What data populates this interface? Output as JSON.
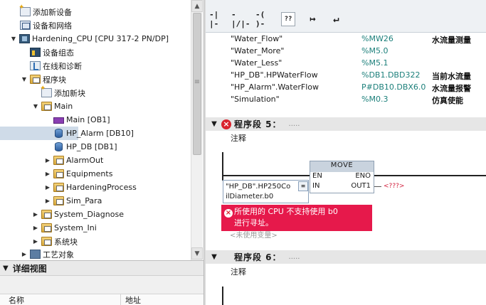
{
  "tree": {
    "items": [
      {
        "label": "添加新设备",
        "icon": "add-new-icon"
      },
      {
        "label": "设备和网络",
        "icon": "network-icon"
      },
      {
        "label": "Hardening_CPU [CPU 317-2 PN/DP]",
        "icon": "cpu-icon"
      },
      {
        "label": "设备组态",
        "icon": "device-config-icon"
      },
      {
        "label": "在线和诊断",
        "icon": "online-diagnostics-icon"
      },
      {
        "label": "程序块",
        "icon": "folder-icon"
      },
      {
        "label": "添加新块",
        "icon": "add-new-icon"
      },
      {
        "label": "Main",
        "icon": "folder-icon"
      },
      {
        "label": "Main [OB1]",
        "icon": "ob-icon"
      },
      {
        "label": "HP_Alarm [DB10]",
        "icon": "db-icon"
      },
      {
        "label": "HP_DB [DB1]",
        "icon": "db-icon"
      },
      {
        "label": "AlarmOut",
        "icon": "folder-icon"
      },
      {
        "label": "Equipments",
        "icon": "folder-icon"
      },
      {
        "label": "HardeningProcess",
        "icon": "folder-icon"
      },
      {
        "label": "Sim_Para",
        "icon": "folder-icon"
      },
      {
        "label": "System_Diagnose",
        "icon": "folder-icon"
      },
      {
        "label": "System_Ini",
        "icon": "folder-icon"
      },
      {
        "label": "系统块",
        "icon": "folder-icon"
      },
      {
        "label": "工艺对象",
        "icon": "tech-object-icon"
      }
    ]
  },
  "detail": {
    "title": "详细视图",
    "col_name": "名称",
    "col_address": "地址"
  },
  "toolbar": {
    "no_contact": "-| |-",
    "nc_contact": "-|/|-",
    "coil": "-( )-",
    "empty_box": "??",
    "open_branch": "↦",
    "close_branch": "↵"
  },
  "interface_rows": [
    {
      "name": "\"Water_Flow\"",
      "address": "%MW26",
      "comment": "水流量测量"
    },
    {
      "name": "\"Water_More\"",
      "address": "%M5.0",
      "comment": ""
    },
    {
      "name": "\"Water_Less\"",
      "address": "%M5.1",
      "comment": ""
    },
    {
      "name": "\"HP_DB\".HPWaterFlow",
      "address": "%DB1.DBD322",
      "comment": "当前水流量"
    },
    {
      "name": "\"HP_Alarm\".WaterFlow",
      "address": "P#DB10.DBX6.0",
      "comment": "水流量报警"
    },
    {
      "name": "\"Simulation\"",
      "address": "%M0.3",
      "comment": "仿真使能"
    }
  ],
  "network5": {
    "title": "程序段 5：",
    "dots": ".....",
    "comment": "注释",
    "box_title": "MOVE",
    "pin_en": "EN",
    "pin_eno": "ENO",
    "pin_in": "IN",
    "pin_out": "OUT1",
    "operand_line1": "\"HP_DB\".HP250Co",
    "operand_line2": "ilDiameter.b0",
    "out_placeholder": "<???>",
    "error_line1": "所使用的 CPU 不支持使用 b0",
    "error_line2": "进行寻址。",
    "unused_var": "<未使用变量>"
  },
  "network6": {
    "title": "程序段 6：",
    "dots": ".....",
    "comment": "注释"
  }
}
